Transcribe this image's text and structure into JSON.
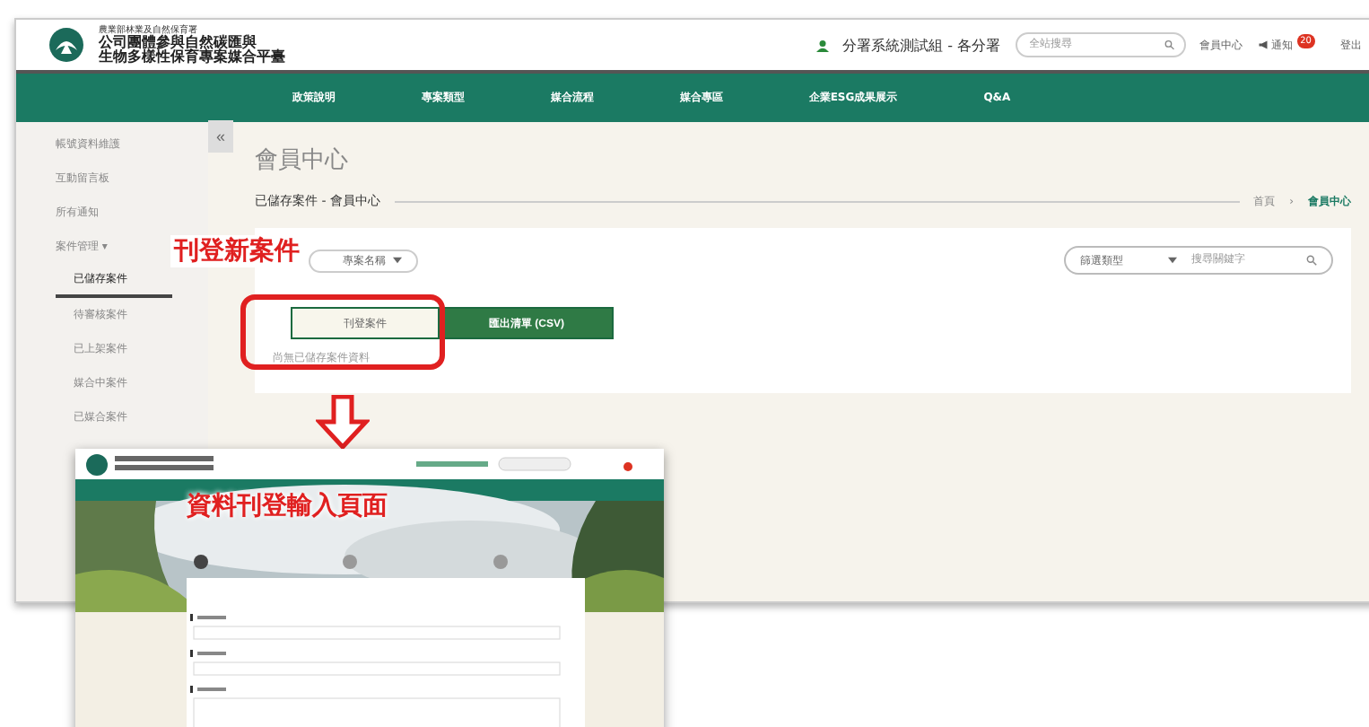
{
  "header": {
    "agency": "農業部林業及自然保育署",
    "title_lines": [
      "公司團體參與自然碳匯與",
      "生物多樣性保育專案媒合平臺"
    ],
    "user": "分署系統測試組 - 各分署",
    "search": {
      "placeholder": "全站搜尋"
    },
    "links": [
      {
        "kind": "link",
        "label": "會員中心"
      },
      {
        "kind": "notify",
        "label": "通知",
        "badge": "20"
      },
      {
        "kind": "link",
        "label": "登出"
      }
    ]
  },
  "nav": [
    "政策說明",
    "專案類型",
    "媒合流程",
    "媒合專區",
    "企業ESG成果展示",
    "Q&A"
  ],
  "sidebar": {
    "collapse": "«",
    "items": [
      {
        "label": "帳號資料維護",
        "selected": false
      },
      {
        "label": "互動留言板",
        "selected": false
      },
      {
        "label": "所有通知",
        "selected": false
      },
      {
        "label": "案件管理 ▾",
        "selected": false,
        "children": [
          {
            "label": "已儲存案件",
            "selected": true
          },
          {
            "label": "待審核案件",
            "selected": false
          },
          {
            "label": "已上架案件",
            "selected": false
          },
          {
            "label": "媒合中案件",
            "selected": false
          },
          {
            "label": "已媒合案件",
            "selected": false
          }
        ]
      }
    ]
  },
  "page": {
    "title": "會員中心",
    "subtitle": "已儲存案件 - 會員中心",
    "breadcrumb_separator": "›",
    "breadcrumb": [
      {
        "label": "首頁",
        "selected": false
      },
      {
        "label": "會員中心",
        "selected": true
      }
    ]
  },
  "card": {
    "sort": "專案名稱",
    "buttons": [
      {
        "kind": "outline",
        "label": "刊登案件"
      },
      {
        "kind": "solid",
        "label": "匯出清單 (CSV)"
      }
    ],
    "empty_text": "尚無已儲存案件資料",
    "filter": "篩選類型",
    "search": {
      "placeholder": "搜尋關鍵字"
    }
  },
  "annotations": {
    "callout": "刊登新案件",
    "inset_caption": "資料刊登輸入頁面"
  }
}
